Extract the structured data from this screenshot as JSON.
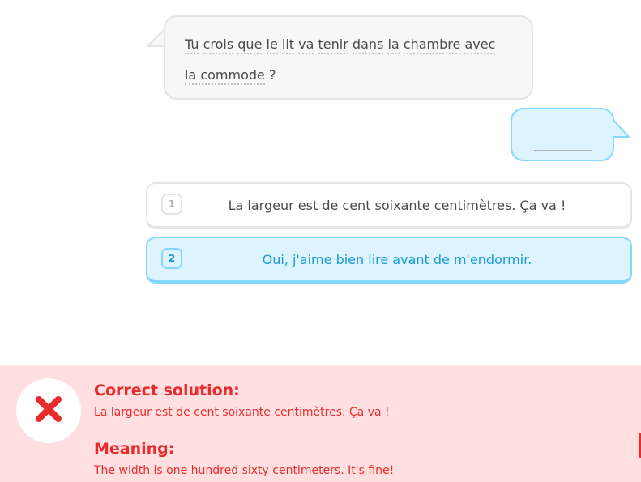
{
  "prompt": {
    "words": [
      "Tu",
      "crois",
      "que",
      "le",
      "lit",
      "va",
      "tenir",
      "dans",
      "la",
      "chambre",
      "avec"
    ],
    "line2": [
      "la",
      "commode"
    ],
    "trailing": "?"
  },
  "options": [
    {
      "number": "1",
      "text": "La largeur est de cent soixante centimètres. Ça va !",
      "selected": false
    },
    {
      "number": "2",
      "text": "Oui, j'aime bien lire avant de m'endormir.",
      "selected": true
    }
  ],
  "feedback": {
    "solution_label": "Correct solution:",
    "solution_text": "La largeur est de cent soixante centimètres. Ça va !",
    "meaning_label": "Meaning:",
    "meaning_text": "The width is one hundred sixty centimeters. It's fine!",
    "status": "incorrect",
    "accent_color": "#ea2b2b",
    "background_color": "#ffdfe0"
  },
  "icons": {
    "feedback_icon": "close-x-icon"
  }
}
